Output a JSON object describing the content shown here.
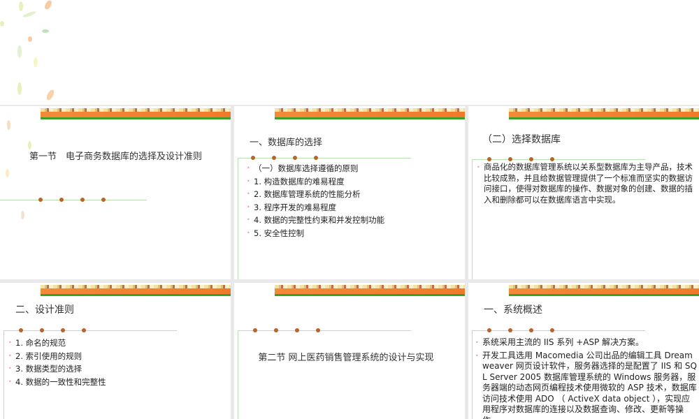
{
  "slides": [
    {
      "title": "第一节　电子商务数据库的选择及设计准则"
    },
    {
      "title": "一、数据库的选择",
      "items": [
        "（一）数据库选择遵循的原则",
        "1. 构造数据库的难易程度",
        "2. 数据库管理系统的性能分析",
        "3. 程序开发的难易程度",
        "4. 数据的完整性约束和并发控制功能",
        "5. 安全性控制"
      ]
    },
    {
      "title": "（二）选择数据库",
      "items": [
        "商品化的数据库管理系统以关系型数据库为主导产品，技术比较成熟，并且给数据管理提供了一个标准而坚实的数据访问接口，使得对数据库的操作、数据对象的创建、数据的插入和删除都可以在数据库语言中实现。"
      ]
    },
    {
      "title": "二、设计准则",
      "items": [
        "1. 命名的规范",
        "2. 索引使用的规则",
        "3. 数据类型的选择",
        "4. 数据的一致性和完整性"
      ]
    },
    {
      "title": "第二节  网上医药销售管理系统的设计与实现"
    },
    {
      "title": "一、系统概述",
      "items": [
        "系统采用主流的 IIS 系列 +ASP 解决方案。",
        "开发工具选用 Macomedia 公司出品的编辑工具 Dreamweaver 网页设计软件，服务器选择的是配置了 IIS 和 SQL Server 2005 数据库管理系统的 Windows 服务器，服务器端的动态网页编程技术使用微软的 ASP 技术，数据库访问技术使用 ADO （ ActiveX data object ），实现应用程序对数据库的连接以及数据查询、修改、更新等操作。"
      ]
    }
  ]
}
